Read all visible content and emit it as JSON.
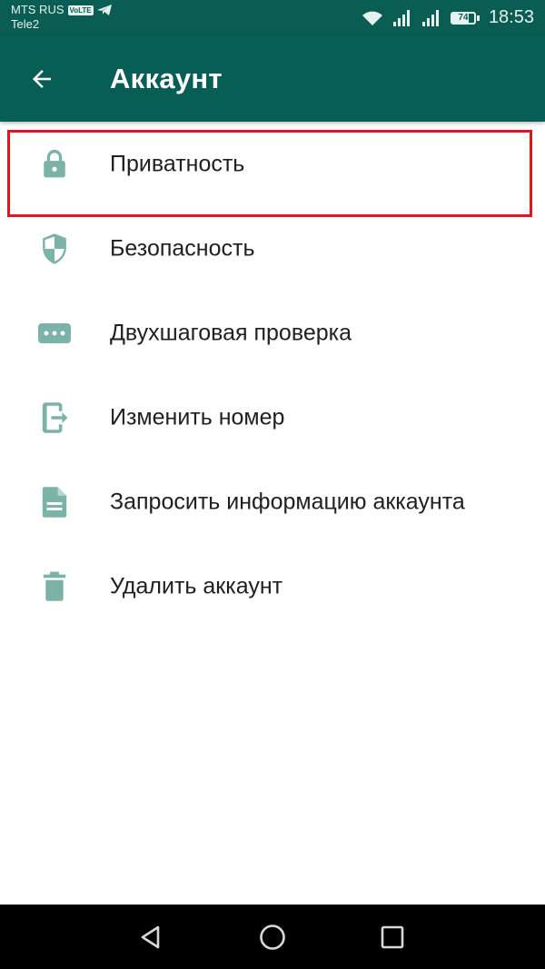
{
  "status_bar": {
    "carrier1": "MTS RUS",
    "carrier1_badge": "VoLTE",
    "carrier2": "Tele2",
    "battery_percent": "74",
    "battery_level": 0.74,
    "time": "18:53"
  },
  "app_bar": {
    "title": "Аккаунт",
    "back_icon": "arrow-left-icon"
  },
  "menu": {
    "items": [
      {
        "label": "Приватность",
        "icon": "lock-icon",
        "highlighted": true
      },
      {
        "label": "Безопасность",
        "icon": "shield-icon"
      },
      {
        "label": "Двухшаговая проверка",
        "icon": "dots-pin-icon"
      },
      {
        "label": "Изменить номер",
        "icon": "change-number-icon"
      },
      {
        "label": "Запросить информацию аккаунта",
        "icon": "document-icon"
      },
      {
        "label": "Удалить аккаунт",
        "icon": "trash-icon"
      }
    ]
  },
  "nav_bar": {
    "back": "triangle-back-icon",
    "home": "circle-home-icon",
    "recents": "square-recents-icon"
  },
  "colors": {
    "status_bar": "#0a5d52",
    "app_bar": "#075e54",
    "icon_tint": "#7bb3a8",
    "highlight": "#e8141b",
    "text": "#202020"
  }
}
